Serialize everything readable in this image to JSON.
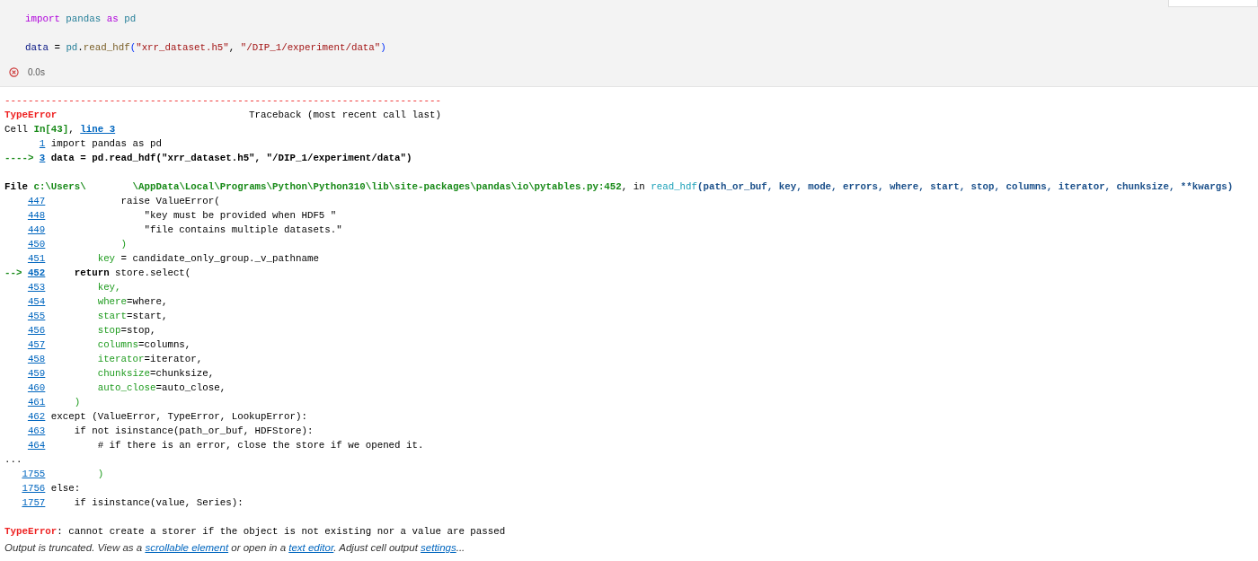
{
  "cell": {
    "code_lines": [
      {
        "kind": "code",
        "segments": [
          {
            "text": "import ",
            "kind": "keyword"
          },
          {
            "text": "pandas ",
            "kind": "module"
          },
          {
            "text": "as ",
            "kind": "keyword"
          },
          {
            "text": "pd",
            "kind": "module"
          }
        ]
      },
      {
        "kind": "blank"
      },
      {
        "kind": "code",
        "segments": [
          {
            "text": "data",
            "kind": "var"
          },
          {
            "text": " = ",
            "kind": "plain"
          },
          {
            "text": "pd",
            "kind": "module"
          },
          {
            "text": ".",
            "kind": "plain"
          },
          {
            "text": "read_hdf",
            "kind": "func"
          },
          {
            "text": "(",
            "kind": "bracket"
          },
          {
            "text": "\"xrr_dataset.h5\"",
            "kind": "string"
          },
          {
            "text": ", ",
            "kind": "plain"
          },
          {
            "text": "\"/DIP_1/experiment/data\"",
            "kind": "string"
          },
          {
            "text": ")",
            "kind": "bracket"
          }
        ]
      }
    ],
    "status": {
      "kind": "error",
      "time": "0.0s"
    }
  },
  "output": {
    "lines": [
      {
        "kind": "separator",
        "text": "---------------------------------------------------------------------------"
      },
      {
        "kind": "header",
        "error_name": "TypeError",
        "traceback": "Traceback (most recent call last)"
      },
      {
        "kind": "text",
        "segments": [
          {
            "text": "Cell ",
            "kind": "plain"
          },
          {
            "text": "In[43]",
            "kind": "greenbold"
          },
          {
            "text": ", ",
            "kind": "plain"
          },
          {
            "text": "line 3",
            "kind": "link"
          }
        ]
      },
      {
        "kind": "source",
        "number": "1",
        "current": false,
        "segments": [
          {
            "text": "import pandas as pd",
            "kind": "plain"
          }
        ]
      },
      {
        "kind": "source",
        "arrow": "---->",
        "number": "3",
        "current": true,
        "segments": [
          {
            "text": "data = pd.read_hdf(\"xrr_dataset.h5\", \"/DIP_1/experiment/data\")",
            "kind": "bold"
          }
        ]
      },
      {
        "kind": "blank"
      },
      {
        "kind": "text",
        "segments": [
          {
            "text": "File ",
            "kind": "bold"
          },
          {
            "text": "c:\\Users\\        \\AppData\\Local\\Programs\\Python\\Python310\\lib\\site-packages\\pandas\\io\\pytables.py:452",
            "kind": "greenbold"
          },
          {
            "text": ", in ",
            "kind": "plain"
          },
          {
            "text": "read_hdf",
            "kind": "teal"
          },
          {
            "text": "(path_or_buf, key, mode, errors, where, start, stop, columns, iterator, chunksize, **kwargs)",
            "kind": "navybold"
          }
        ]
      },
      {
        "kind": "source",
        "number": "447",
        "current": false,
        "segments": [
          {
            "text": "            raise ValueError(",
            "kind": "plain"
          }
        ]
      },
      {
        "kind": "source",
        "number": "448",
        "current": false,
        "segments": [
          {
            "text": "                \"key must be provided when HDF5 \"",
            "kind": "plain"
          }
        ]
      },
      {
        "kind": "source",
        "number": "449",
        "current": false,
        "segments": [
          {
            "text": "                \"file contains multiple datasets.\"",
            "kind": "plain"
          }
        ]
      },
      {
        "kind": "source",
        "number": "450",
        "current": false,
        "segments": [
          {
            "text": "            )",
            "kind": "green"
          }
        ]
      },
      {
        "kind": "source",
        "number": "451",
        "current": false,
        "segments": [
          {
            "text": "        key",
            "kind": "green"
          },
          {
            "text": " = candidate_only_group._v_pathname",
            "kind": "plain"
          }
        ]
      },
      {
        "kind": "source",
        "arrow": "-->",
        "number": "452",
        "current": true,
        "segments": [
          {
            "text": "    return",
            "kind": "bold"
          },
          {
            "text": " store.select(",
            "kind": "plain"
          }
        ]
      },
      {
        "kind": "source",
        "number": "453",
        "current": false,
        "segments": [
          {
            "text": "        key,",
            "kind": "green"
          }
        ]
      },
      {
        "kind": "source",
        "number": "454",
        "current": false,
        "segments": [
          {
            "text": "        where",
            "kind": "green"
          },
          {
            "text": "=where,",
            "kind": "plain"
          }
        ]
      },
      {
        "kind": "source",
        "number": "455",
        "current": false,
        "segments": [
          {
            "text": "        start",
            "kind": "green"
          },
          {
            "text": "=start,",
            "kind": "plain"
          }
        ]
      },
      {
        "kind": "source",
        "number": "456",
        "current": false,
        "segments": [
          {
            "text": "        stop",
            "kind": "green"
          },
          {
            "text": "=stop,",
            "kind": "plain"
          }
        ]
      },
      {
        "kind": "source",
        "number": "457",
        "current": false,
        "segments": [
          {
            "text": "        columns",
            "kind": "green"
          },
          {
            "text": "=columns,",
            "kind": "plain"
          }
        ]
      },
      {
        "kind": "source",
        "number": "458",
        "current": false,
        "segments": [
          {
            "text": "        iterator",
            "kind": "green"
          },
          {
            "text": "=iterator,",
            "kind": "plain"
          }
        ]
      },
      {
        "kind": "source",
        "number": "459",
        "current": false,
        "segments": [
          {
            "text": "        chunksize",
            "kind": "green"
          },
          {
            "text": "=chunksize,",
            "kind": "plain"
          }
        ]
      },
      {
        "kind": "source",
        "number": "460",
        "current": false,
        "segments": [
          {
            "text": "        auto_close",
            "kind": "green"
          },
          {
            "text": "=auto_close,",
            "kind": "plain"
          }
        ]
      },
      {
        "kind": "source",
        "number": "461",
        "current": false,
        "segments": [
          {
            "text": "    )",
            "kind": "green"
          }
        ]
      },
      {
        "kind": "source",
        "number": "462",
        "current": false,
        "segments": [
          {
            "text": "except (ValueError, TypeError, LookupError):",
            "kind": "plain"
          }
        ]
      },
      {
        "kind": "source",
        "number": "463",
        "current": false,
        "segments": [
          {
            "text": "    if not isinstance(path_or_buf, HDFStore):",
            "kind": "plain"
          }
        ]
      },
      {
        "kind": "source",
        "number": "464",
        "current": false,
        "segments": [
          {
            "text": "        # if there is an error, close the store if we opened it.",
            "kind": "plain"
          }
        ]
      },
      {
        "kind": "text",
        "segments": [
          {
            "text": "...",
            "kind": "plain"
          }
        ]
      },
      {
        "kind": "source",
        "number": "1755",
        "current": false,
        "segments": [
          {
            "text": "        )",
            "kind": "green"
          }
        ]
      },
      {
        "kind": "source",
        "number": "1756",
        "current": false,
        "segments": [
          {
            "text": "else:",
            "kind": "plain"
          }
        ]
      },
      {
        "kind": "source",
        "number": "1757",
        "current": false,
        "segments": [
          {
            "text": "    if isinstance(value, Series):",
            "kind": "plain"
          }
        ]
      },
      {
        "kind": "blank"
      },
      {
        "kind": "text",
        "segments": [
          {
            "text": "TypeError",
            "kind": "redbold"
          },
          {
            "text": ": cannot create a storer if the object is not existing nor a value are passed",
            "kind": "plain"
          }
        ]
      }
    ],
    "footer": [
      {
        "text": "Output is truncated. View as a ",
        "kind": "text"
      },
      {
        "text": "scrollable element",
        "kind": "link"
      },
      {
        "text": " or open in a ",
        "kind": "text"
      },
      {
        "text": "text editor",
        "kind": "link"
      },
      {
        "text": ". Adjust cell output ",
        "kind": "text"
      },
      {
        "text": "settings",
        "kind": "link"
      },
      {
        "text": "...",
        "kind": "text"
      }
    ]
  }
}
